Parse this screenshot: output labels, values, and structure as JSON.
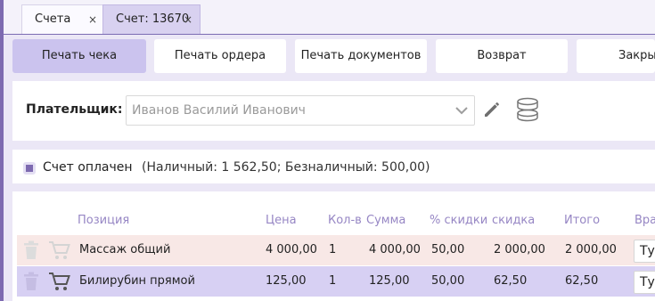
{
  "tabs": [
    {
      "label": "Счета",
      "close": "×"
    },
    {
      "label": "Счет: 13670",
      "close": "×"
    }
  ],
  "toolbar": {
    "print_receipt": "Печать чека",
    "print_order": "Печать ордера",
    "print_documents": "Печать документов",
    "refund": "Возврат",
    "close": "Закрыть"
  },
  "payer": {
    "label": "Плательщик:",
    "value": "Иванов Василий Иванович",
    "icons": [
      "chevron-down-icon",
      "pencil-icon",
      "database-icon"
    ]
  },
  "payment": {
    "checked": true,
    "label": "Счет оплачен",
    "details": "(Наличный: 1 562,50; Безналичный: 500,00)"
  },
  "table": {
    "headers": {
      "position": "Позиция",
      "price": "Цена",
      "qty": "Кол-в",
      "sum": "Сумма",
      "discount_pct": "% скидки",
      "discount": "скидка",
      "total": "Итого",
      "type": "Вра"
    },
    "rows": [
      {
        "position": "Массаж общий",
        "price": "4 000,00",
        "qty": "1",
        "sum": "4 000,00",
        "discount_pct": "50,00",
        "discount": "2 000,00",
        "total": "2 000,00",
        "type": "Ту"
      },
      {
        "position": "Билирубин прямой",
        "price": "125,00",
        "qty": "1",
        "sum": "125,00",
        "discount_pct": "50,00",
        "discount": "62,50",
        "total": "62,50",
        "type": "Ту"
      }
    ]
  },
  "colors": {
    "accent": "#7d6ab0",
    "header_text": "#9686c4",
    "row_1_bg": "#f8e8e6",
    "row_2_bg": "#d7d0f3",
    "page_bg": "#ebe7f6"
  }
}
